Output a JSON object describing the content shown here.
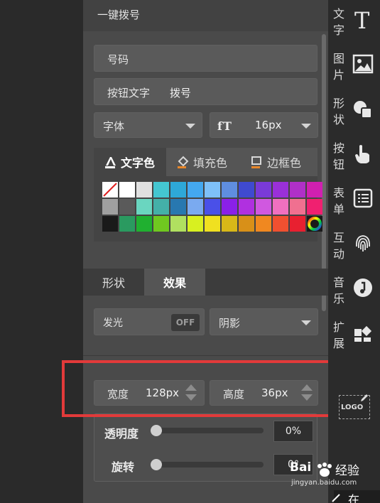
{
  "panel": {
    "title": "一键拨号",
    "phone_label": "号码",
    "button_text_label": "按钮文字",
    "button_text_value": "拨号",
    "font_select": "字体",
    "font_size": "16px"
  },
  "color_tabs": {
    "text_color": "文字色",
    "fill_color": "填充色",
    "border_color": "边框色"
  },
  "swatches": {
    "row1": [
      "#ffffff",
      "#ffffff",
      "#e0e0e0",
      "#44c6d0",
      "#2ea8d8",
      "#44a8f0",
      "#7ec0f8",
      "#5f8ee0",
      "#3f4ad0",
      "#7a3ad8",
      "#9a30d8",
      "#b030c8",
      "#d020b0"
    ],
    "row2": [
      "#a0a0a0",
      "#5a5a5a",
      "#6ad6c0",
      "#44b0a8",
      "#2878b0",
      "#7aaaf0",
      "#4a50e8",
      "#8a20e8",
      "#b030e0",
      "#d058e0",
      "#f070c0",
      "#f07090",
      "#f02070"
    ],
    "row3": [
      "#1a1a1a",
      "#2a9a60",
      "#20b030",
      "#70c820",
      "#b0e060",
      "#d8f020",
      "#f0e020",
      "#d8b818",
      "#d89018",
      "#f08820",
      "#f05030",
      "#e82030",
      "#rainbow"
    ]
  },
  "effect_tabs": {
    "shape": "形状",
    "effect": "效果"
  },
  "glow": {
    "label": "发光",
    "toggle": "OFF"
  },
  "shadow": {
    "label": "阴影"
  },
  "size": {
    "width_label": "宽度",
    "width_value": "128px",
    "height_label": "高度",
    "height_value": "36px"
  },
  "opacity": {
    "label": "透明度",
    "value": "0%",
    "level": 0
  },
  "rotate": {
    "label": "旋转",
    "value": "0°",
    "level": 0
  },
  "sidebar": {
    "items": [
      {
        "label_top": "文",
        "label_bottom": "字",
        "icon": "text-icon"
      },
      {
        "label_top": "图",
        "label_bottom": "片",
        "icon": "image-icon"
      },
      {
        "label_top": "形",
        "label_bottom": "状",
        "icon": "shape-icon"
      },
      {
        "label_top": "按",
        "label_bottom": "钮",
        "icon": "hand-pointer-icon"
      },
      {
        "label_top": "表",
        "label_bottom": "单",
        "icon": "form-list-icon"
      },
      {
        "label_top": "互",
        "label_bottom": "动",
        "icon": "fingerprint-icon"
      },
      {
        "label_top": "音",
        "label_bottom": "乐",
        "icon": "music-icon"
      },
      {
        "label_top": "扩",
        "label_bottom": "展",
        "icon": "apps-icon"
      }
    ],
    "logo_text": "LOGO"
  },
  "watermark": {
    "brand": "Bai",
    "sub": "经验",
    "url": "jingyan.baidu.com"
  },
  "corner_text": "在",
  "colors": {
    "panel_bg": "#4a4a4a",
    "highlight": "#e23a3a",
    "sidebar_bg": "#2b2b2b"
  }
}
